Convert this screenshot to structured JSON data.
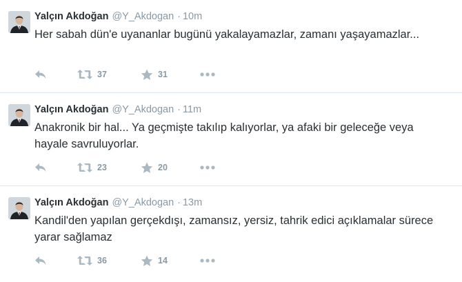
{
  "tweets": [
    {
      "fullname": "Yalçın Akdoğan",
      "username": "@Y_Akdogan",
      "separator": "·",
      "time": "10m",
      "text": "Her sabah dün'e uyananlar bugünü yakalayamazlar, zamanı yaşayamazlar...",
      "retweets": "37",
      "favorites": "31"
    },
    {
      "fullname": "Yalçın Akdoğan",
      "username": "@Y_Akdogan",
      "separator": "·",
      "time": "11m",
      "text": "Anakronik bir hal... Ya geçmişte takılıp kalıyorlar, ya afaki bir geleceğe veya hayale savruluyorlar.",
      "retweets": "23",
      "favorites": "20"
    },
    {
      "fullname": "Yalçın Akdoğan",
      "username": "@Y_Akdogan",
      "separator": "·",
      "time": "13m",
      "text": "Kandil'den yapılan gerçekdışı, zamansız, yersiz, tahrik edici açıklamalar sürece yarar sağlamaz",
      "retweets": "36",
      "favorites": "14"
    }
  ],
  "icons": {
    "reply": "reply-icon",
    "retweet": "retweet-icon",
    "favorite": "star-icon",
    "more": "more-dots-icon"
  },
  "colors": {
    "name": "#292f33",
    "meta": "#8899a6",
    "icon": "#aab8c2",
    "divider": "#e1e8ed"
  }
}
